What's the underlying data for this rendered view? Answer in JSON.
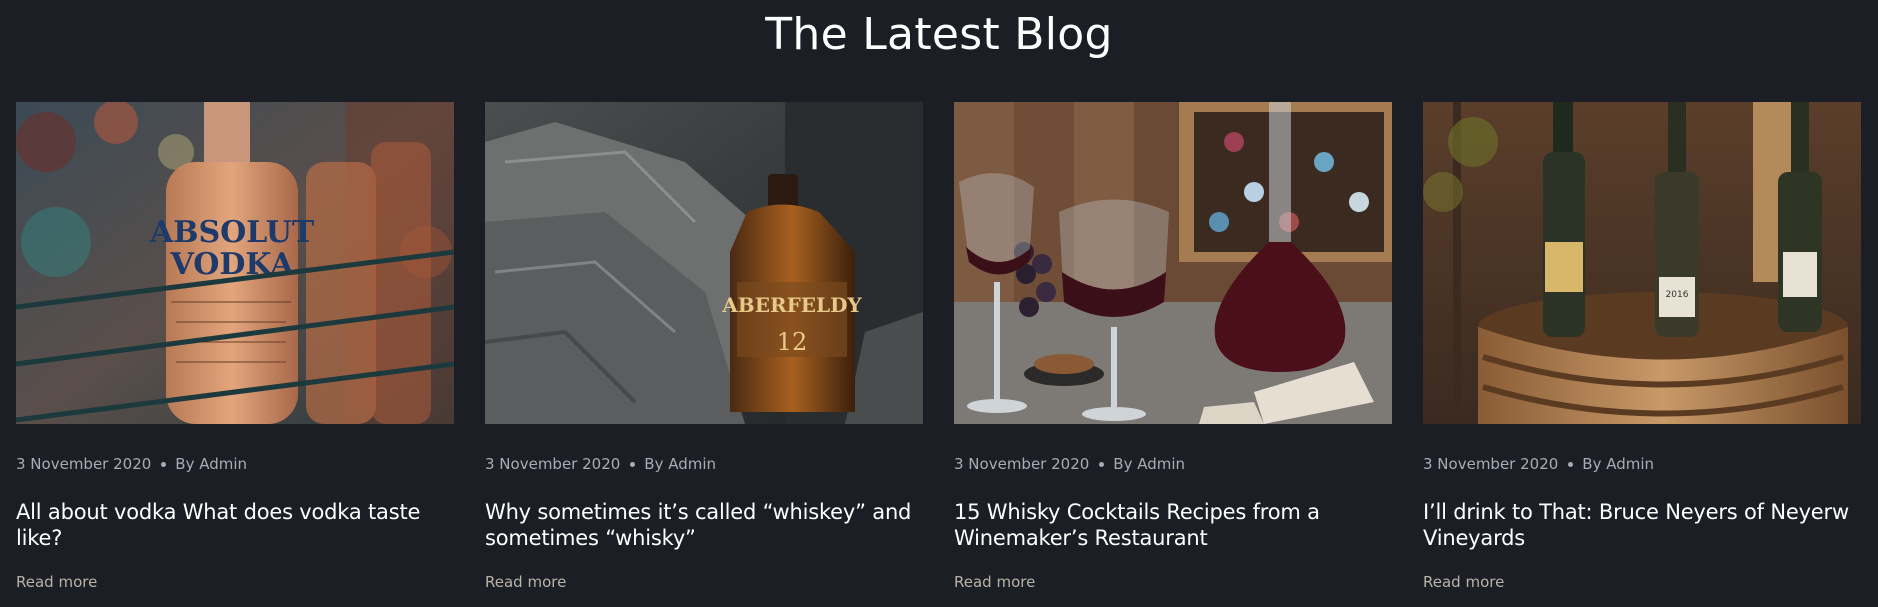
{
  "section": {
    "title": "The Latest Blog"
  },
  "posts": [
    {
      "date": "3 November 2020",
      "author": "By Admin",
      "title": "All about vodka What does vodka taste like?",
      "read_more": "Read more",
      "image": {
        "label_line1": "ABSOLUT",
        "label_line2": "VODKA"
      }
    },
    {
      "date": "3 November 2020",
      "author": "By Admin",
      "title": "Why sometimes it’s called “whiskey” and sometimes “whisky”",
      "read_more": "Read more",
      "image": {
        "label_line1": "ABERFELDY",
        "label_line2": "12"
      }
    },
    {
      "date": "3 November 2020",
      "author": "By Admin",
      "title": "15 Whisky Cocktails Recipes from a Winemaker’s Restaurant",
      "read_more": "Read more",
      "image": {}
    },
    {
      "date": "3 November 2020",
      "author": "By Admin",
      "title": "I’ll drink to That: Bruce Neyers of Neyerw Vineyards",
      "read_more": "Read more",
      "image": {
        "label_line1": "2016"
      }
    }
  ],
  "colors": {
    "background": "#1b1e25",
    "title": "#ffffff",
    "meta": "#a8acb4",
    "read_more": "#b9b3a6"
  }
}
